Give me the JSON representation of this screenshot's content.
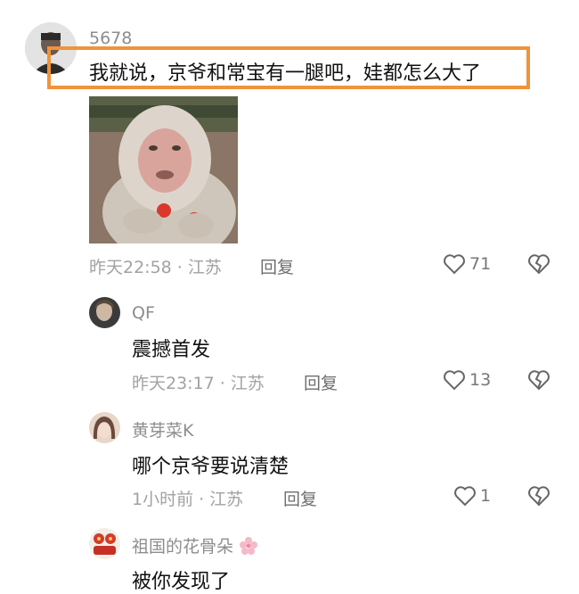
{
  "main_comment": {
    "username": "5678",
    "text": "我就说，京爷和常宝有一腿吧，娃都怎么大了",
    "time": "昨天22:58",
    "location": "江苏",
    "reply_label": "回复",
    "likes": "71"
  },
  "replies": [
    {
      "username": "QF",
      "text": "震撼首发",
      "time": "昨天23:17",
      "location": "江苏",
      "reply_label": "回复",
      "likes": "13"
    },
    {
      "username": "黄芽菜K",
      "text": "哪个京爷要说清楚",
      "time": "1小时前",
      "location": "江苏",
      "reply_label": "回复",
      "likes": "1"
    },
    {
      "username": "祖国的花骨朵",
      "text": "被你发现了"
    }
  ],
  "icons": {
    "like": "heart-outline-icon",
    "dislike": "broken-heart-icon",
    "flower": "cherry-blossom-icon"
  },
  "colors": {
    "highlight_border": "#f0933a",
    "username": "#8d8d8d",
    "meta": "#a2a2a2"
  }
}
